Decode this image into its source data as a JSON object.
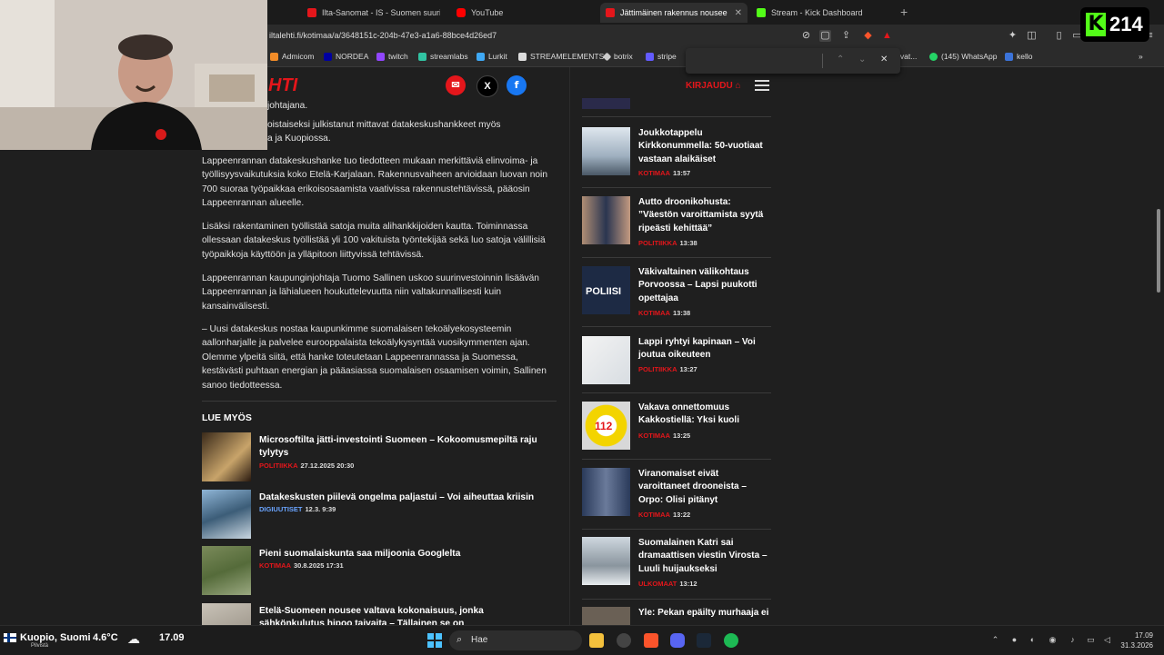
{
  "colors": {
    "accent": "#e4161b",
    "kick_green": "#53fc18"
  },
  "browser": {
    "tabs": [
      {
        "label": "Ilta-Sanomat - IS - Suomen suurin uu",
        "icon": "is-favicon"
      },
      {
        "label": "YouTube",
        "icon": "youtube-favicon"
      },
      {
        "label": "Jättimäinen rakennus nousee Itä",
        "icon": "iltalehti-favicon"
      },
      {
        "label": "Stream - Kick Dashboard",
        "icon": "kick-favicon"
      }
    ],
    "new_tab": "+",
    "url": "iltalehti.fi/kotimaa/a/3648151c-204b-47e3-a1a6-88bce4d26ed7",
    "bookmarks": [
      "Admicom",
      "NORDEA",
      "twitch",
      "streamlabs",
      "Lurkit",
      "STREAMELEMENTS",
      "botrix",
      "stripe",
      "ivat...",
      "(145) WhatsApp",
      "kello"
    ]
  },
  "kick": {
    "logo": "K",
    "count": "214"
  },
  "header": {
    "logo": "HTI",
    "login": "KIRJAUDU"
  },
  "article": {
    "partial_top": "johtajana.",
    "para0": "oistaiseksi julkistanut mittavat datakeskushankkeet myös",
    "para0b": "a ja Kuopiossa.",
    "paragraphs": [
      "Lappeenrannan datakeskushanke tuo tiedotteen mukaan merkittäviä elinvoima- ja työllisyysvaikutuksia koko Etelä-Karjalaan. Rakennusvaiheen arvioidaan luovan noin 700 suoraa työpaikkaa erikoisosaamista vaativissa rakennustehtävissä, pääosin Lappeenrannan alueelle.",
      "Lisäksi rakentaminen työllistää satoja muita alihankkijoiden kautta. Toiminnassa ollessaan datakeskus työllistää yli 100 vakituista työntekijää sekä luo satoja välillisiä työpaikkoja käyttöön ja ylläpitoon liittyvissä tehtävissä.",
      "Lappeenrannan kaupunginjohtaja Tuomo Sallinen uskoo suurinvestoinnin lisäävän Lappeenrannan ja lähialueen houkuttelevuutta niin valtakunnallisesti kuin kansainvälisesti.",
      "– Uusi datakeskus nostaa kaupunkimme suomalaisen tekoälyekosysteemin aallonharjalle ja palvelee eurooppalaista tekoälykysyntää vuosikymmenten ajan. Olemme ylpeitä siitä, että hanke toteutetaan Lappeenrannassa ja Suomessa, kestävästi puhtaan energian ja pääasiassa suomalaisen osaamisen voimin, Sallinen sanoo tiedotteessa."
    ],
    "related_heading": "LUE MYÖS",
    "related": [
      {
        "title": "Microsoftilta jätti-investointi Suomeen – Kokoomusmepiltä raju tylytys",
        "category": "POLITIIKKA",
        "time": "27.12.2025 20:30"
      },
      {
        "title": "Datakeskusten piilevä ongelma paljastui – Voi aiheuttaa kriisin",
        "category": "DIGIUUTISET",
        "time": "12.3. 9:39"
      },
      {
        "title": "Pieni suomalaiskunta saa miljoonia Googlelta",
        "category": "KOTIMAA",
        "time": "30.8.2025 17:31"
      },
      {
        "title": "Etelä-Suomeen nousee valtava kokonaisuus, jonka sähkönkulutus hipoo taivaita – Tällainen se on",
        "category": "",
        "time": ""
      }
    ]
  },
  "sidebar": [
    {
      "title": "Joukkotappelu Kirkkonummella: 50-vuotiaat vastaan alaikäiset",
      "category": "KOTIMAA",
      "time": "13:57"
    },
    {
      "title": "Autto droonikohusta: ”Väestön varoittamista syytä ripeästi kehittää”",
      "category": "POLITIIKKA",
      "time": "13:38"
    },
    {
      "title": "Väkivaltainen välikohtaus Porvoossa – Lapsi puukotti opettajaa",
      "category": "KOTIMAA",
      "time": "13:38"
    },
    {
      "title": "Lappi ryhtyi kapinaan – Voi joutua oikeuteen",
      "category": "POLITIIKKA",
      "time": "13:27"
    },
    {
      "title": "Vakava onnettomuus Kakkostiellä: Yksi kuoli",
      "category": "KOTIMAA",
      "time": "13:25"
    },
    {
      "title": "Viranomaiset eivät varoittaneet drooneista – Orpo: Olisi pitänyt",
      "category": "KOTIMAA",
      "time": "13:22"
    },
    {
      "title": "Suomalainen Katri sai dramaattisen viestin Virosta – Luuli huijaukseksi",
      "category": "ULKOMAAT",
      "time": "13:12"
    },
    {
      "title": "Yle: Pekan epäilty murhaaja ei",
      "category": "",
      "time": ""
    }
  ],
  "taskbar": {
    "weather_location": "Kuopio, Suomi",
    "weather_temp": "4.6°C",
    "weather_sub": "Pilvistä",
    "time_left": "17.09",
    "search": "Hae",
    "clock_time": "17.09",
    "clock_date": "31.3.2026"
  }
}
